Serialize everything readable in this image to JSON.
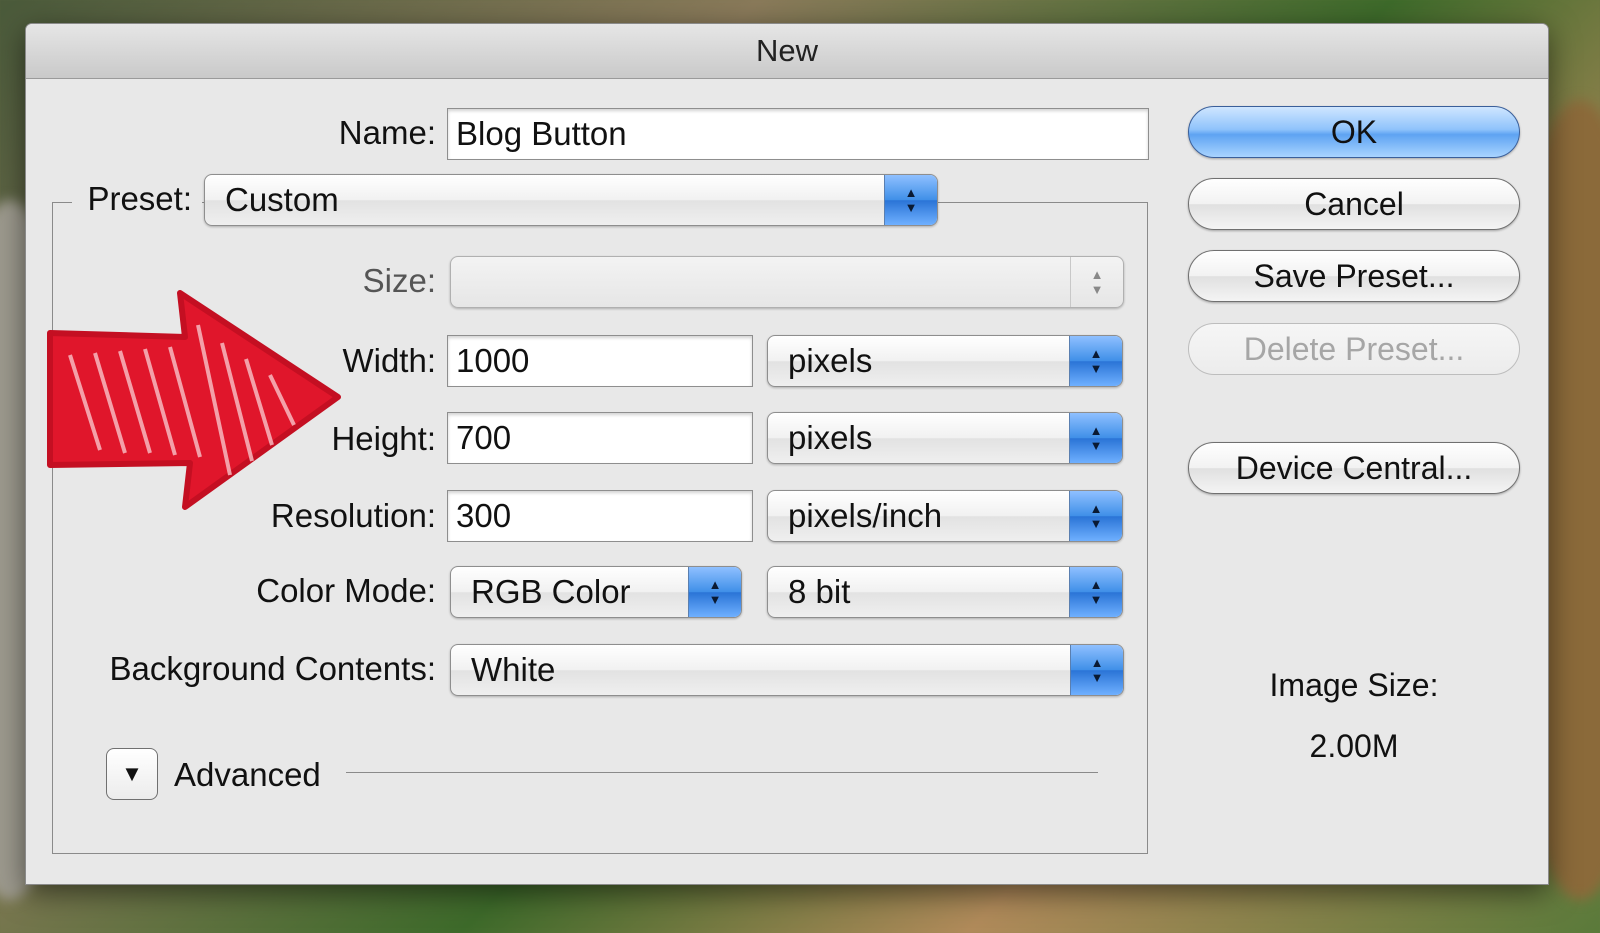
{
  "dialog": {
    "title": "New"
  },
  "name": {
    "label": "Name:",
    "value": "Blog Button"
  },
  "preset": {
    "label": "Preset:",
    "value": "Custom"
  },
  "size": {
    "label": "Size:",
    "value": ""
  },
  "width": {
    "label": "Width:",
    "value": "1000",
    "unit": "pixels"
  },
  "height": {
    "label": "Height:",
    "value": "700",
    "unit": "pixels"
  },
  "resolution": {
    "label": "Resolution:",
    "value": "300",
    "unit": "pixels/inch"
  },
  "color_mode": {
    "label": "Color Mode:",
    "value": "RGB Color",
    "bit_depth": "8 bit"
  },
  "background": {
    "label": "Background Contents:",
    "value": "White"
  },
  "advanced": {
    "label": "Advanced"
  },
  "buttons": {
    "ok": "OK",
    "cancel": "Cancel",
    "save_preset": "Save Preset...",
    "delete_preset": "Delete Preset...",
    "device_central": "Device Central..."
  },
  "image_size": {
    "label": "Image Size:",
    "value": "2.00M"
  },
  "colors": {
    "annotation_arrow": "#e0162b",
    "accent": "#3f8fe8"
  },
  "icons": {
    "popup_arrows": "up-down-arrows-icon",
    "annotation": "arrow-right-icon",
    "disclosure": "triangle-down-icon"
  }
}
